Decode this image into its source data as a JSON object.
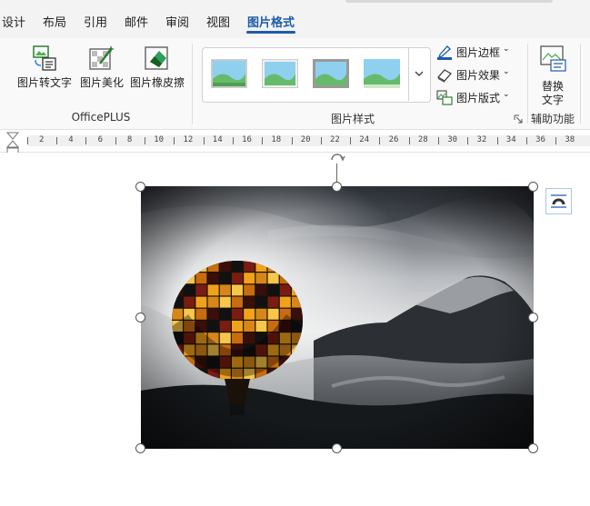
{
  "tabs": {
    "design": "设计",
    "layout": "布局",
    "references": "引用",
    "mailings": "邮件",
    "review": "审阅",
    "view": "视图",
    "picture_format": "图片格式"
  },
  "ribbon": {
    "officeplus": {
      "convert_label": "图片转文字",
      "beautify_label": "图片美化",
      "eraser_label": "图片橡皮擦",
      "group_label": "OfficePLUS"
    },
    "picture_styles": {
      "group_label": "图片样式",
      "border_label": "图片边框",
      "effects_label": "图片效果",
      "layout_label": "图片版式",
      "caret": "⌄"
    },
    "accessibility": {
      "alt_text_line1": "替换",
      "alt_text_line2": "文字",
      "group_label": "辅助功能"
    }
  },
  "ruler": {
    "labels": [
      "2",
      "4",
      "6",
      "8",
      "10",
      "12",
      "14",
      "16",
      "18",
      "20",
      "22",
      "24",
      "26",
      "28",
      "30",
      "32",
      "34",
      "36",
      "38"
    ]
  },
  "colors": {
    "accent": "#1e5ba8",
    "tab_bar": "#f3f3f3",
    "ribbon": "#f9f9f9"
  }
}
